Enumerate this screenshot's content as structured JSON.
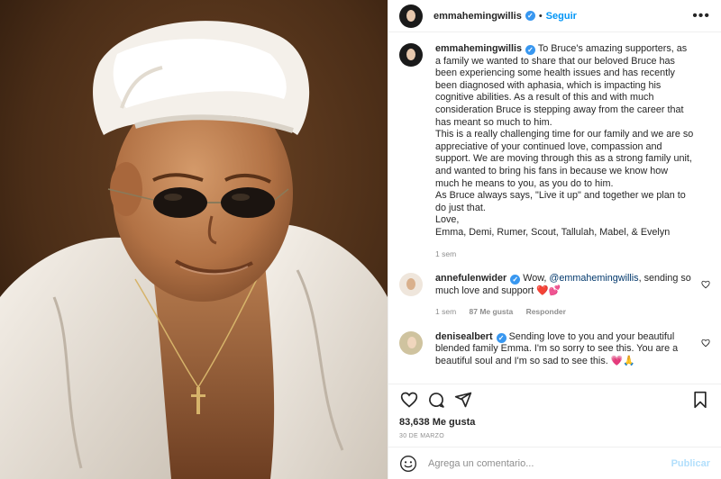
{
  "header": {
    "username": "emmahemingwillis",
    "verified_icon": "verified-icon",
    "separator": "•",
    "follow_label": "Seguir",
    "more_label": "•••"
  },
  "caption": {
    "username": "emmahemingwillis",
    "lines": [
      "To Bruce's amazing supporters, as a family we wanted to share that our beloved Bruce has been experiencing some health issues and has recently been diagnosed with aphasia, which is impacting his cognitive abilities. As a result of this and with much consideration Bruce is stepping away from the career that has meant so much to him.",
      "This is a really challenging time for our family and we are so appreciative of your continued love, compassion and support. We are moving through this as a strong family unit, and wanted to bring his fans in because we know how much he means to you, as you do to him.",
      "As Bruce always says, \"Live it up\" and together we plan to do just that.",
      "Love,",
      "Emma, Demi, Rumer, Scout, Tallulah, Mabel, & Evelyn"
    ],
    "time": "1 sem"
  },
  "comments": [
    {
      "username": "annefulenwider",
      "text_before": "Wow, ",
      "mention": "@emmahemingwillis",
      "text_after": ", sending so much love and support ❤️💕",
      "time": "1 sem",
      "likes": "87 Me gusta",
      "reply": "Responder"
    },
    {
      "username": "denisealbert",
      "text": "Sending love to you and your beautiful blended family Emma. I'm so sorry to see this. You are a beautiful soul and I'm so sad to see this. 💗🙏"
    }
  ],
  "actions": {
    "icons": [
      "heart-icon",
      "comment-icon",
      "share-icon",
      "bookmark-icon"
    ]
  },
  "likes_count": "83,638 Me gusta",
  "post_date": "30 DE MARZO",
  "add_comment": {
    "placeholder": "Agrega un comentario...",
    "publish_label": "Publicar"
  },
  "colors": {
    "link": "#0095f6",
    "verified": "#3897f0",
    "muted": "#8e8e8e",
    "publish_disabled": "#b2dffc",
    "heart_red": "#ed4956"
  }
}
